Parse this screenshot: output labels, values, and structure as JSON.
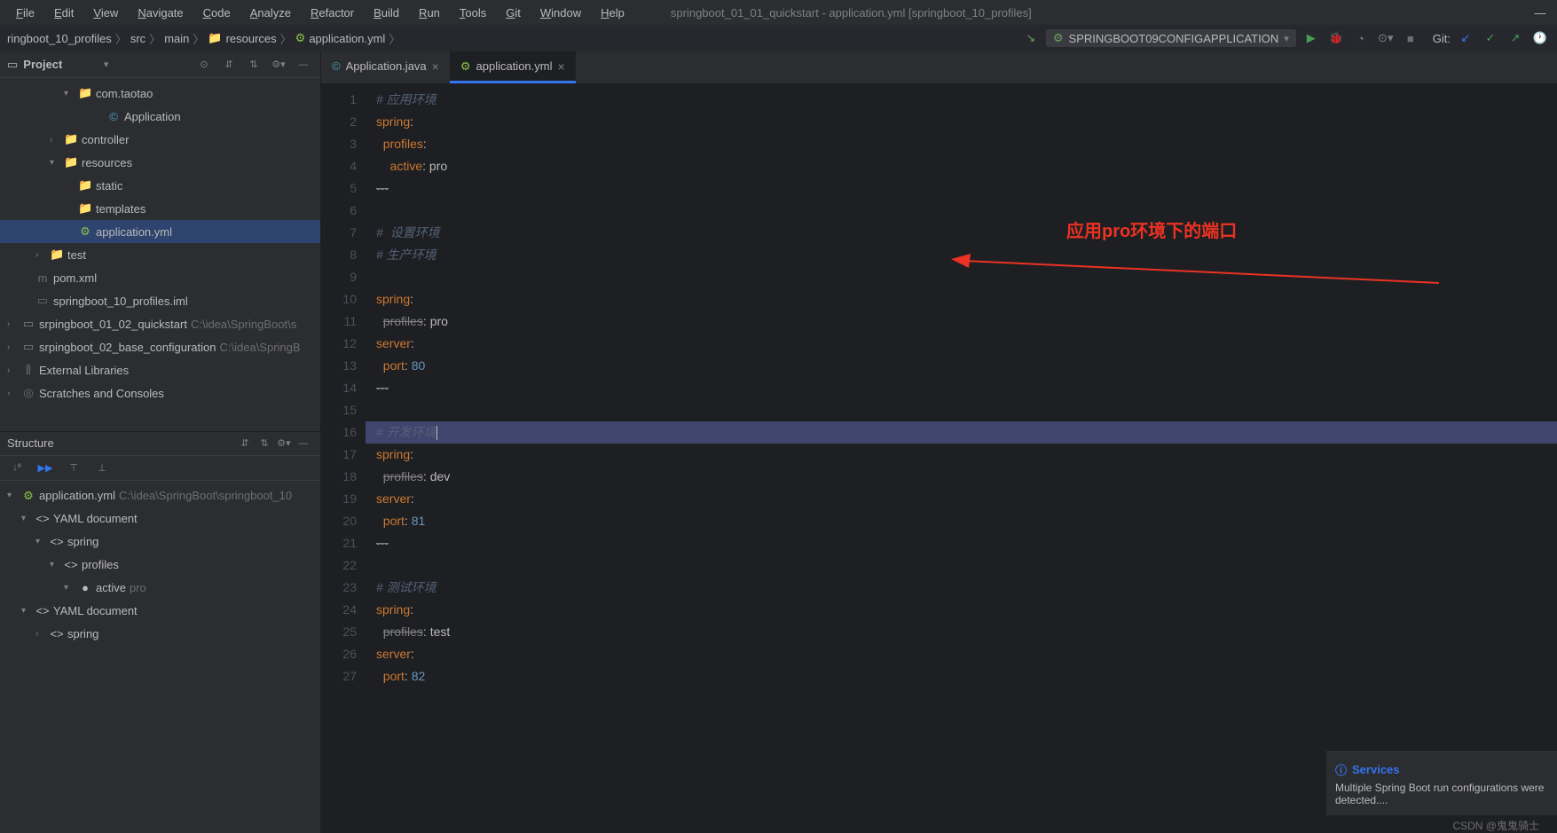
{
  "window": {
    "title": "springboot_01_01_quickstart - application.yml [springboot_10_profiles]"
  },
  "menu": [
    "File",
    "Edit",
    "View",
    "Navigate",
    "Code",
    "Analyze",
    "Refactor",
    "Build",
    "Run",
    "Tools",
    "Git",
    "Window",
    "Help"
  ],
  "breadcrumb": [
    "ringboot_10_profiles",
    "src",
    "main",
    "resources",
    "application.yml"
  ],
  "runConfig": "SPRINGBOOT09CONFIGAPPLICATION",
  "gitLabel": "Git:",
  "projectPanel": {
    "title": "Project",
    "items": [
      {
        "indent": 4,
        "arrow": "▾",
        "icon": "📁",
        "label": "com.taotao",
        "cls": "folder-icon"
      },
      {
        "indent": 6,
        "arrow": "",
        "icon": "©",
        "label": "Application",
        "cls": "java-icon"
      },
      {
        "indent": 3,
        "arrow": "›",
        "icon": "📁",
        "label": "controller",
        "cls": "folder-icon"
      },
      {
        "indent": 3,
        "arrow": "▾",
        "icon": "📁",
        "label": "resources",
        "cls": "folder-icon"
      },
      {
        "indent": 4,
        "arrow": "",
        "icon": "📁",
        "label": "static",
        "cls": "folder-icon"
      },
      {
        "indent": 4,
        "arrow": "",
        "icon": "📁",
        "label": "templates",
        "cls": "folder-icon"
      },
      {
        "indent": 4,
        "arrow": "",
        "icon": "⚙",
        "label": "application.yml",
        "cls": "yml-icon",
        "selected": true
      },
      {
        "indent": 2,
        "arrow": "›",
        "icon": "📁",
        "label": "test",
        "cls": "folder-icon"
      },
      {
        "indent": 1,
        "arrow": "",
        "icon": "m",
        "label": "pom.xml",
        "cls": "file-icon"
      },
      {
        "indent": 1,
        "arrow": "",
        "icon": "▭",
        "label": "springboot_10_profiles.iml",
        "cls": "file-icon"
      },
      {
        "indent": 0,
        "arrow": "›",
        "icon": "▭",
        "label": "srpingboot_01_02_quickstart",
        "hint": " C:\\idea\\SpringBoot\\s",
        "cls": "folder-icon"
      },
      {
        "indent": 0,
        "arrow": "›",
        "icon": "▭",
        "label": "srpingboot_02_base_configuration",
        "hint": " C:\\idea\\SpringB",
        "cls": "folder-icon"
      },
      {
        "indent": 0,
        "arrow": "›",
        "icon": "⫼",
        "label": "External Libraries",
        "cls": "file-icon"
      },
      {
        "indent": 0,
        "arrow": "›",
        "icon": "◎",
        "label": "Scratches and Consoles",
        "cls": "file-icon"
      }
    ]
  },
  "structurePanel": {
    "title": "Structure",
    "items": [
      {
        "indent": 0,
        "arrow": "▾",
        "icon": "⚙",
        "label": "application.yml",
        "hint": " C:\\idea\\SpringBoot\\springboot_10",
        "cls": "yml-icon"
      },
      {
        "indent": 1,
        "arrow": "▾",
        "icon": "<>",
        "label": "YAML document"
      },
      {
        "indent": 2,
        "arrow": "▾",
        "icon": "<>",
        "label": "spring"
      },
      {
        "indent": 3,
        "arrow": "▾",
        "icon": "<>",
        "label": "profiles"
      },
      {
        "indent": 4,
        "arrow": "▾",
        "icon": "●",
        "label": "active",
        "val": " pro",
        "cls": "purple"
      },
      {
        "indent": 1,
        "arrow": "▾",
        "icon": "<>",
        "label": "YAML document"
      },
      {
        "indent": 2,
        "arrow": "›",
        "icon": "<>",
        "label": "spring"
      }
    ]
  },
  "tabs": [
    {
      "icon": "©",
      "label": "Application.java",
      "active": false
    },
    {
      "icon": "⚙",
      "label": "application.yml",
      "active": true
    }
  ],
  "code": {
    "lines": [
      {
        "n": 1,
        "seg": [
          {
            "t": "# 应用环境",
            "c": "comment"
          }
        ]
      },
      {
        "n": 2,
        "seg": [
          {
            "t": "spring",
            "c": "key"
          },
          {
            "t": ":",
            "c": "sep"
          }
        ]
      },
      {
        "n": 3,
        "seg": [
          {
            "t": "  profiles",
            "c": "key"
          },
          {
            "t": ":",
            "c": "sep"
          }
        ]
      },
      {
        "n": 4,
        "seg": [
          {
            "t": "    active",
            "c": "key"
          },
          {
            "t": ": ",
            "c": "sep"
          },
          {
            "t": "pro",
            "c": "string"
          }
        ]
      },
      {
        "n": 5,
        "seg": [
          {
            "t": "---",
            "c": "strike"
          }
        ]
      },
      {
        "n": 6,
        "seg": []
      },
      {
        "n": 7,
        "seg": [
          {
            "t": "#  设置环境",
            "c": "comment"
          }
        ]
      },
      {
        "n": 8,
        "seg": [
          {
            "t": "# 生产环境",
            "c": "comment"
          }
        ]
      },
      {
        "n": 9,
        "seg": []
      },
      {
        "n": 10,
        "seg": [
          {
            "t": "spring",
            "c": "key"
          },
          {
            "t": ":",
            "c": "sep"
          }
        ]
      },
      {
        "n": 11,
        "seg": [
          {
            "t": "  ",
            "c": "sep"
          },
          {
            "t": "profiles",
            "c": "strike"
          },
          {
            "t": ": ",
            "c": "sep"
          },
          {
            "t": "pro",
            "c": "string"
          }
        ]
      },
      {
        "n": 12,
        "seg": [
          {
            "t": "server",
            "c": "key"
          },
          {
            "t": ":",
            "c": "sep"
          }
        ]
      },
      {
        "n": 13,
        "seg": [
          {
            "t": "  port",
            "c": "key"
          },
          {
            "t": ": ",
            "c": "sep"
          },
          {
            "t": "80",
            "c": "number"
          }
        ]
      },
      {
        "n": 14,
        "seg": [
          {
            "t": "---",
            "c": "strike"
          }
        ]
      },
      {
        "n": 15,
        "seg": []
      },
      {
        "n": 16,
        "hl": true,
        "seg": [
          {
            "t": "# 开发环境",
            "c": "comment"
          }
        ],
        "cursor": true
      },
      {
        "n": 17,
        "seg": [
          {
            "t": "spring",
            "c": "key"
          },
          {
            "t": ":",
            "c": "sep"
          }
        ]
      },
      {
        "n": 18,
        "seg": [
          {
            "t": "  ",
            "c": "sep"
          },
          {
            "t": "profiles",
            "c": "strike"
          },
          {
            "t": ": ",
            "c": "sep"
          },
          {
            "t": "dev",
            "c": "string"
          }
        ]
      },
      {
        "n": 19,
        "seg": [
          {
            "t": "server",
            "c": "key"
          },
          {
            "t": ":",
            "c": "sep"
          }
        ]
      },
      {
        "n": 20,
        "seg": [
          {
            "t": "  port",
            "c": "key"
          },
          {
            "t": ": ",
            "c": "sep"
          },
          {
            "t": "81",
            "c": "number"
          }
        ]
      },
      {
        "n": 21,
        "seg": [
          {
            "t": "---",
            "c": "strike"
          }
        ]
      },
      {
        "n": 22,
        "seg": []
      },
      {
        "n": 23,
        "seg": [
          {
            "t": "# 测试环境",
            "c": "comment"
          }
        ]
      },
      {
        "n": 24,
        "seg": [
          {
            "t": "spring",
            "c": "key"
          },
          {
            "t": ":",
            "c": "sep"
          }
        ]
      },
      {
        "n": 25,
        "seg": [
          {
            "t": "  ",
            "c": "sep"
          },
          {
            "t": "profiles",
            "c": "strike"
          },
          {
            "t": ": ",
            "c": "sep"
          },
          {
            "t": "test",
            "c": "string"
          }
        ]
      },
      {
        "n": 26,
        "seg": [
          {
            "t": "server",
            "c": "key"
          },
          {
            "t": ":",
            "c": "sep"
          }
        ]
      },
      {
        "n": 27,
        "seg": [
          {
            "t": "  port",
            "c": "key"
          },
          {
            "t": ": ",
            "c": "sep"
          },
          {
            "t": "82",
            "c": "number"
          }
        ]
      }
    ]
  },
  "annotation": "应用pro环境下的端口",
  "notification": {
    "title": "Services",
    "body": "Multiple Spring Boot run configurations were detected...."
  },
  "watermark": "CSDN @鬼鬼骑士"
}
